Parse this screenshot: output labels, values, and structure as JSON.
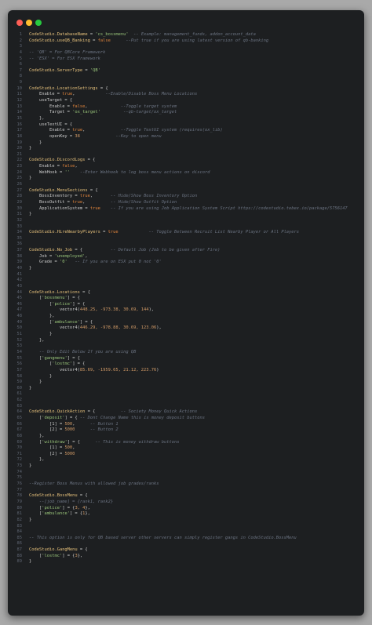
{
  "window": {
    "title": "",
    "colors": {
      "background": "#1d1f21",
      "identifier": "#e5c07b",
      "keyword": "#e0843c",
      "string": "#98c379",
      "number": "#d19a66",
      "plain": "#c8c8c8",
      "comment": "#6a7280",
      "line_number": "#5c6370"
    },
    "buttons": [
      {
        "name": "close-button",
        "color": "#ff5f56"
      },
      {
        "name": "minimize-button",
        "color": "#ffbd2e"
      },
      {
        "name": "maximize-button",
        "color": "#27c93f"
      }
    ]
  },
  "editor": {
    "lines": [
      [
        {
          "t": "CodeStudio.DatabaseName",
          "c": "id"
        },
        {
          "t": " = ",
          "c": "pl"
        },
        {
          "t": "'cs_bossmenu'",
          "c": "str"
        },
        {
          "t": "  -- Example: management_funds, addon_account_data",
          "c": "cm"
        }
      ],
      [
        {
          "t": "CodeStudio.useQB_Banking",
          "c": "id"
        },
        {
          "t": " = ",
          "c": "pl"
        },
        {
          "t": "false",
          "c": "kw"
        },
        {
          "t": "      --Put true if you are using latest version of qb-banking",
          "c": "cm"
        }
      ],
      [],
      [
        {
          "t": "-- 'QB' = For QBCore Framework",
          "c": "cm"
        }
      ],
      [
        {
          "t": "-- 'ESX' = For ESX Framework",
          "c": "cm"
        }
      ],
      [],
      [
        {
          "t": "CodeStudio.ServerType",
          "c": "id"
        },
        {
          "t": " = ",
          "c": "pl"
        },
        {
          "t": "'QB'",
          "c": "str"
        }
      ],
      [],
      [],
      [
        {
          "t": "CodeStudio.LocationSettings",
          "c": "id"
        },
        {
          "t": " = {",
          "c": "pl"
        }
      ],
      [
        {
          "t": "    Enable = ",
          "c": "pl"
        },
        {
          "t": "true",
          "c": "kw"
        },
        {
          "t": ",",
          "c": "pl"
        },
        {
          "t": "            --Enable/Disable Boss Menu Locations",
          "c": "cm"
        }
      ],
      [
        {
          "t": "    useTarget = {",
          "c": "pl"
        }
      ],
      [
        {
          "t": "        Enable = ",
          "c": "pl"
        },
        {
          "t": "false",
          "c": "kw"
        },
        {
          "t": ",",
          "c": "pl"
        },
        {
          "t": "             --Toggle target system",
          "c": "cm"
        }
      ],
      [
        {
          "t": "        Target = ",
          "c": "pl"
        },
        {
          "t": "'ox_target'",
          "c": "str"
        },
        {
          "t": "         --qb-target/ox_target",
          "c": "cm"
        }
      ],
      [
        {
          "t": "    },",
          "c": "pl"
        }
      ],
      [
        {
          "t": "    useTextUI = {",
          "c": "pl"
        }
      ],
      [
        {
          "t": "        Enable = ",
          "c": "pl"
        },
        {
          "t": "true",
          "c": "kw"
        },
        {
          "t": ",",
          "c": "pl"
        },
        {
          "t": "              --Toggle TextUI system (requires(ox_lib)",
          "c": "cm"
        }
      ],
      [
        {
          "t": "        openKey = ",
          "c": "pl"
        },
        {
          "t": "38",
          "c": "num"
        },
        {
          "t": "              --Key to open menu",
          "c": "cm"
        }
      ],
      [
        {
          "t": "    }",
          "c": "pl"
        }
      ],
      [
        {
          "t": "}",
          "c": "pl"
        }
      ],
      [],
      [
        {
          "t": "CodeStudio.DiscordLogs",
          "c": "id"
        },
        {
          "t": " = {",
          "c": "pl"
        }
      ],
      [
        {
          "t": "    Enable = ",
          "c": "pl"
        },
        {
          "t": "false",
          "c": "kw"
        },
        {
          "t": ",",
          "c": "pl"
        }
      ],
      [
        {
          "t": "    WebHook = ",
          "c": "pl"
        },
        {
          "t": "''",
          "c": "str"
        },
        {
          "t": "    --Enter Webhook to log boss menu actions on discord",
          "c": "cm"
        }
      ],
      [
        {
          "t": "}",
          "c": "pl"
        }
      ],
      [],
      [
        {
          "t": "CodeStudio.MenuSections",
          "c": "id"
        },
        {
          "t": " = {",
          "c": "pl"
        }
      ],
      [
        {
          "t": "    BossInventory = ",
          "c": "pl"
        },
        {
          "t": "true",
          "c": "kw"
        },
        {
          "t": ",",
          "c": "pl"
        },
        {
          "t": "       -- Hide/Show Boss Inventory Option",
          "c": "cm"
        }
      ],
      [
        {
          "t": "    BossOutfit = ",
          "c": "pl"
        },
        {
          "t": "true",
          "c": "kw"
        },
        {
          "t": ",",
          "c": "pl"
        },
        {
          "t": "          -- Hide/Show Outfit Option",
          "c": "cm"
        }
      ],
      [
        {
          "t": "    ApplicationSystem = ",
          "c": "pl"
        },
        {
          "t": "true",
          "c": "kw"
        },
        {
          "t": "    -- If you are using Job Application System Script https://codestudio.tebex.io/package/5756147",
          "c": "cm"
        }
      ],
      [
        {
          "t": "}",
          "c": "pl"
        }
      ],
      [],
      [],
      [
        {
          "t": "CodeStudio.HireNearbyPlayers",
          "c": "id"
        },
        {
          "t": " = ",
          "c": "pl"
        },
        {
          "t": "true",
          "c": "kw"
        },
        {
          "t": "            -- Toggle Between Recruit List Nearby Player or All Players",
          "c": "cm"
        }
      ],
      [],
      [],
      [
        {
          "t": "CodeStudio.No_Job",
          "c": "id"
        },
        {
          "t": " = {",
          "c": "pl"
        },
        {
          "t": "           -- Default Job (Job to be given after Fire)",
          "c": "cm"
        }
      ],
      [
        {
          "t": "    Job = ",
          "c": "pl"
        },
        {
          "t": "'unemployed'",
          "c": "str"
        },
        {
          "t": ",",
          "c": "pl"
        }
      ],
      [
        {
          "t": "    Grade = ",
          "c": "pl"
        },
        {
          "t": "'0'",
          "c": "str"
        },
        {
          "t": "   -- If you are on ESX put 0 not '0'",
          "c": "cm"
        }
      ],
      [
        {
          "t": "}",
          "c": "pl"
        }
      ],
      [],
      [],
      [],
      [
        {
          "t": "CodeStudio.Locations",
          "c": "id"
        },
        {
          "t": " = {",
          "c": "pl"
        }
      ],
      [
        {
          "t": "    [",
          "c": "pl"
        },
        {
          "t": "'bossmenu'",
          "c": "str"
        },
        {
          "t": "] = {",
          "c": "pl"
        }
      ],
      [
        {
          "t": "        [",
          "c": "pl"
        },
        {
          "t": "'police'",
          "c": "str"
        },
        {
          "t": "] = {",
          "c": "pl"
        }
      ],
      [
        {
          "t": "            vector4(",
          "c": "pl"
        },
        {
          "t": "448.25, -973.38, 30.69, 144",
          "c": "num"
        },
        {
          "t": "),",
          "c": "pl"
        }
      ],
      [
        {
          "t": "        },",
          "c": "pl"
        }
      ],
      [
        {
          "t": "        [",
          "c": "pl"
        },
        {
          "t": "'ambulance'",
          "c": "str"
        },
        {
          "t": "] = {",
          "c": "pl"
        }
      ],
      [
        {
          "t": "            vector4(",
          "c": "pl"
        },
        {
          "t": "446.29, -978.88, 30.69, 123.06",
          "c": "num"
        },
        {
          "t": "),",
          "c": "pl"
        }
      ],
      [
        {
          "t": "        }",
          "c": "pl"
        }
      ],
      [
        {
          "t": "    },",
          "c": "pl"
        }
      ],
      [],
      [
        {
          "t": "    -- Only Edit Below If you are using QB",
          "c": "cm"
        }
      ],
      [
        {
          "t": "    [",
          "c": "pl"
        },
        {
          "t": "'gangmenu'",
          "c": "str"
        },
        {
          "t": "] = {",
          "c": "pl"
        }
      ],
      [
        {
          "t": "        [",
          "c": "pl"
        },
        {
          "t": "'lostmc'",
          "c": "str"
        },
        {
          "t": "] = {",
          "c": "pl"
        }
      ],
      [
        {
          "t": "            vector4(",
          "c": "pl"
        },
        {
          "t": "85.69, -1959.65, 21.12, 223.76",
          "c": "num"
        },
        {
          "t": ")",
          "c": "pl"
        }
      ],
      [
        {
          "t": "        }",
          "c": "pl"
        }
      ],
      [
        {
          "t": "    }",
          "c": "pl"
        }
      ],
      [
        {
          "t": "}",
          "c": "pl"
        }
      ],
      [],
      [],
      [],
      [
        {
          "t": "CodeStudio.QuickAction",
          "c": "id"
        },
        {
          "t": " = {",
          "c": "pl"
        },
        {
          "t": "          -- Society Money Quick Actions",
          "c": "cm"
        }
      ],
      [
        {
          "t": "    [",
          "c": "pl"
        },
        {
          "t": "'deposit'",
          "c": "str"
        },
        {
          "t": "] = {",
          "c": "pl"
        },
        {
          "t": " -- Dont Change Name this is money deposit buttons",
          "c": "cm"
        }
      ],
      [
        {
          "t": "        [1] = ",
          "c": "pl"
        },
        {
          "t": "500",
          "c": "num"
        },
        {
          "t": ",",
          "c": "pl"
        },
        {
          "t": "      -- Button 1",
          "c": "cm"
        }
      ],
      [
        {
          "t": "        [2] = ",
          "c": "pl"
        },
        {
          "t": "5000",
          "c": "num"
        },
        {
          "t": "      -- Button 2",
          "c": "cm"
        }
      ],
      [
        {
          "t": "    },",
          "c": "pl"
        }
      ],
      [
        {
          "t": "    [",
          "c": "pl"
        },
        {
          "t": "'withdraw'",
          "c": "str"
        },
        {
          "t": "] = {",
          "c": "pl"
        },
        {
          "t": "      -- This is money withdraw buttons",
          "c": "cm"
        }
      ],
      [
        {
          "t": "        [1] = ",
          "c": "pl"
        },
        {
          "t": "500",
          "c": "num"
        },
        {
          "t": ",",
          "c": "pl"
        }
      ],
      [
        {
          "t": "        [2] = ",
          "c": "pl"
        },
        {
          "t": "5000",
          "c": "num"
        }
      ],
      [
        {
          "t": "    },",
          "c": "pl"
        }
      ],
      [
        {
          "t": "}",
          "c": "pl"
        }
      ],
      [],
      [],
      [
        {
          "t": "--Register Boss Menus with allowed job grades/ranks",
          "c": "cm"
        }
      ],
      [],
      [
        {
          "t": "CodeStudio.BossMenu",
          "c": "id"
        },
        {
          "t": " = {",
          "c": "pl"
        }
      ],
      [
        {
          "t": "    --[job_name] = {rank1, rank2}",
          "c": "cm"
        }
      ],
      [
        {
          "t": "    [",
          "c": "pl"
        },
        {
          "t": "'police'",
          "c": "str"
        },
        {
          "t": "] = {",
          "c": "pl"
        },
        {
          "t": "3, 4",
          "c": "num"
        },
        {
          "t": "},",
          "c": "pl"
        }
      ],
      [
        {
          "t": "    [",
          "c": "pl"
        },
        {
          "t": "'ambulance'",
          "c": "str"
        },
        {
          "t": "] = {",
          "c": "pl"
        },
        {
          "t": "1",
          "c": "num"
        },
        {
          "t": "},",
          "c": "pl"
        }
      ],
      [
        {
          "t": "}",
          "c": "pl"
        }
      ],
      [],
      [],
      [
        {
          "t": "-- This option is only for QB based server other servers can simply register gangs in CodeStudio.BossMenu",
          "c": "cm"
        }
      ],
      [],
      [
        {
          "t": "CodeStudio.GangMenu",
          "c": "id"
        },
        {
          "t": " = {",
          "c": "pl"
        }
      ],
      [
        {
          "t": "    [",
          "c": "pl"
        },
        {
          "t": "'lostmc'",
          "c": "str"
        },
        {
          "t": "] = {",
          "c": "pl"
        },
        {
          "t": "3",
          "c": "num"
        },
        {
          "t": "},",
          "c": "pl"
        }
      ],
      [
        {
          "t": "}",
          "c": "pl"
        }
      ]
    ]
  }
}
